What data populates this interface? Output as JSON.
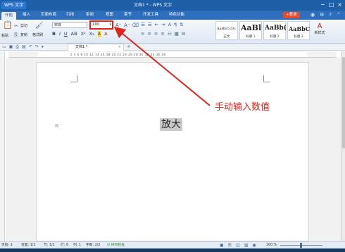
{
  "app": {
    "menu_label": "WPS 文字",
    "window_title": "文档1 * - WPS 文字",
    "window_controls": [
      "−",
      "□",
      "×"
    ]
  },
  "menubar": {
    "tabs": [
      "开始",
      "插入",
      "页面布局",
      "引用",
      "审阅",
      "视图",
      "章节",
      "开发工具",
      "特色功能"
    ],
    "signin": "+登录",
    "icons": [
      "alert-icon",
      "settings-icon",
      "help-icon",
      "collapse-icon"
    ]
  },
  "ribbon": {
    "paste": "粘贴",
    "cut": "剪切",
    "copy": "复制",
    "format_painter": "格式刷",
    "font_name": "宋体",
    "font_size": "100",
    "format_buttons": [
      "B",
      "I",
      "U",
      "AB",
      "X²",
      "X₂",
      "A",
      "A"
    ],
    "para_row1": [
      "☰",
      "☰",
      "⇤",
      "⇥",
      "A",
      "¶",
      "⇅"
    ],
    "para_row2": [
      "≡",
      "≡",
      "≡",
      "≡",
      "☷",
      "▦",
      "⊟"
    ],
    "styles": [
      {
        "sample": "AaBbCcDc",
        "name": "正文",
        "size": "5px"
      },
      {
        "sample": "AaBl",
        "name": "标题 1",
        "size": "11px"
      },
      {
        "sample": "AaBb(",
        "name": "标题 2",
        "size": "9px"
      },
      {
        "sample": "AaBbC",
        "name": "标题 3",
        "size": "8px"
      }
    ],
    "new_style": "新样式"
  },
  "doc_tab": {
    "title": "文档1 *",
    "close": "×",
    "add": "+"
  },
  "ruler": {
    "numbers": "2   4   6   8   10  12  14  16  18  20  22  24  26  28  30  32  34  36  38"
  },
  "document": {
    "selected_text": "放大"
  },
  "status": {
    "page": "页码: 1",
    "pages": "页面: 1/1",
    "section": "节: 1/1",
    "row": "行: 6",
    "col": "列: 1",
    "words": "字数: 2/2",
    "spell": "拼写检查",
    "zoom": "100 %"
  },
  "annotation": {
    "label": "手动输入数值"
  },
  "colors": {
    "accent": "#1f5fa8",
    "annotation": "#e0231a"
  }
}
